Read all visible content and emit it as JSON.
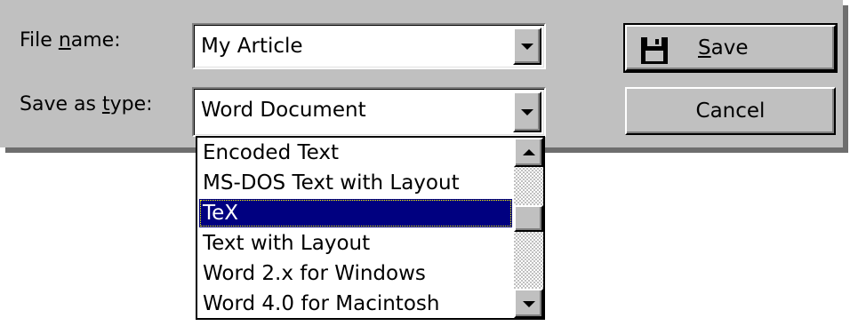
{
  "file_name": {
    "label_before": "File ",
    "label_accel": "n",
    "label_after": "ame:",
    "value": "My Article"
  },
  "save_as_type": {
    "label_before": "Save as ",
    "label_accel": "t",
    "label_after": "ype:",
    "value": "Word Document",
    "options": [
      "Encoded Text",
      "MS-DOS Text with Layout",
      "TeX",
      "Text with Layout",
      "Word 2.x for Windows",
      "Word 4.0 for Macintosh"
    ],
    "selected_option": "TeX"
  },
  "buttons": {
    "save_accel": "S",
    "save_rest": "ave",
    "cancel": "Cancel"
  },
  "icons": {
    "save": "floppy-disk-icon",
    "dropdown": "chevron-down-icon",
    "scroll_up": "scroll-up-arrow-icon",
    "scroll_down": "scroll-down-arrow-icon"
  },
  "colors": {
    "face": "#c0c0c0",
    "selection": "#000080"
  }
}
